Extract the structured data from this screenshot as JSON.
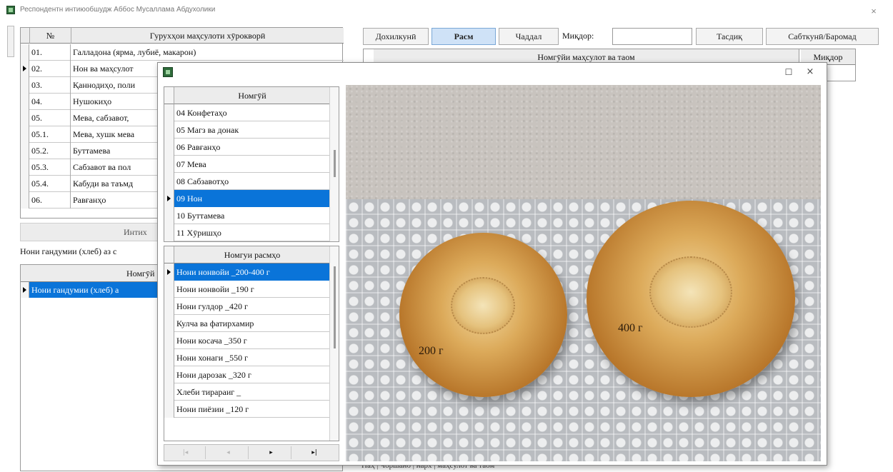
{
  "window": {
    "title": "Респондентн интиюобшудж Аббос Мусаллама Абдухолики",
    "close_glyph": "×"
  },
  "groups_table": {
    "headers": [
      "№",
      "Гурухҳои маҳсулоти хӯрокворӣ"
    ],
    "rows": [
      {
        "num": "01.",
        "name": "Галладона (ярма, лубиё, макарон)",
        "selected": false
      },
      {
        "num": "02.",
        "name": "Нон ва маҳсулот",
        "selected": true
      },
      {
        "num": "03.",
        "name": "Қаннодиҳо, поли",
        "selected": false
      },
      {
        "num": "04.",
        "name": "Нушокиҳо",
        "selected": false
      },
      {
        "num": "05.",
        "name": "Мева, сабзавот,",
        "selected": false
      },
      {
        "num": "05.1.",
        "name": "Мева, хушк мева",
        "selected": false
      },
      {
        "num": "05.2.",
        "name": "Буттамева",
        "selected": false
      },
      {
        "num": "05.3.",
        "name": "Сабзавот ва пол",
        "selected": false
      },
      {
        "num": "05.4.",
        "name": "Кабуди ва таъмд",
        "selected": false
      },
      {
        "num": "06.",
        "name": "Равғанҳо",
        "selected": false
      }
    ]
  },
  "intake": {
    "label": "Интих",
    "bread_line": "Нони гандумии (хлеб) аз с"
  },
  "sub_table": {
    "header": "Номгӯй",
    "row": "Нони гандумии (хлеб) а"
  },
  "toolbar": {
    "buttons": [
      "Дохилкунӣ",
      "Расм",
      "Чаддал",
      "Тасдиқ",
      "Сабткунӣ/Баромад"
    ],
    "qty_label": "Миқдор:",
    "qty_value": ""
  },
  "right_table": {
    "headers": [
      "Номгӯйи маҳсулот ва таом",
      "Миқдор"
    ]
  },
  "bottom_strip": "Наҳ | Чоршанб | нарх | маҳсулот ва таом",
  "popup": {
    "maximize_glyph": "☐",
    "close_glyph": "×",
    "categories": {
      "header": "Номгӯй",
      "items": [
        {
          "label": "04 Конфетаҳо",
          "selected": false
        },
        {
          "label": "05 Магз ва донак",
          "selected": false
        },
        {
          "label": "06 Равғанҳо",
          "selected": false
        },
        {
          "label": "07 Мева",
          "selected": false
        },
        {
          "label": "08 Сабзавотҳо",
          "selected": false
        },
        {
          "label": "09 Нон",
          "selected": true
        },
        {
          "label": "10 Буттамева",
          "selected": false
        },
        {
          "label": "11 Хӯришҳо",
          "selected": false
        }
      ]
    },
    "photos": {
      "header": "Номгуи расмҳо",
      "items": [
        {
          "label": "Нони нонвойи _200-400 г",
          "selected": true
        },
        {
          "label": "Нони нонвойи _190 г",
          "selected": false
        },
        {
          "label": "Нони гулдор _420 г",
          "selected": false
        },
        {
          "label": "Кулча ва фатирхамир",
          "selected": false
        },
        {
          "label": "Нони косача _350 г",
          "selected": false
        },
        {
          "label": "Нони хонаги _550 г",
          "selected": false
        },
        {
          "label": "Нони дарозак _320 г",
          "selected": false
        },
        {
          "label": "Хлеби тирараиг _",
          "selected": false
        },
        {
          "label": "Нони пиёзии _120 г",
          "selected": false
        }
      ]
    },
    "nav": [
      "|◂",
      "◂",
      "▸",
      "▸|"
    ],
    "image": {
      "label_small": "200 г",
      "label_large": "400 г"
    }
  },
  "colors": {
    "selection": "#0a74d9",
    "header_bg": "#ececec",
    "active_button": "#cfe2f7"
  }
}
